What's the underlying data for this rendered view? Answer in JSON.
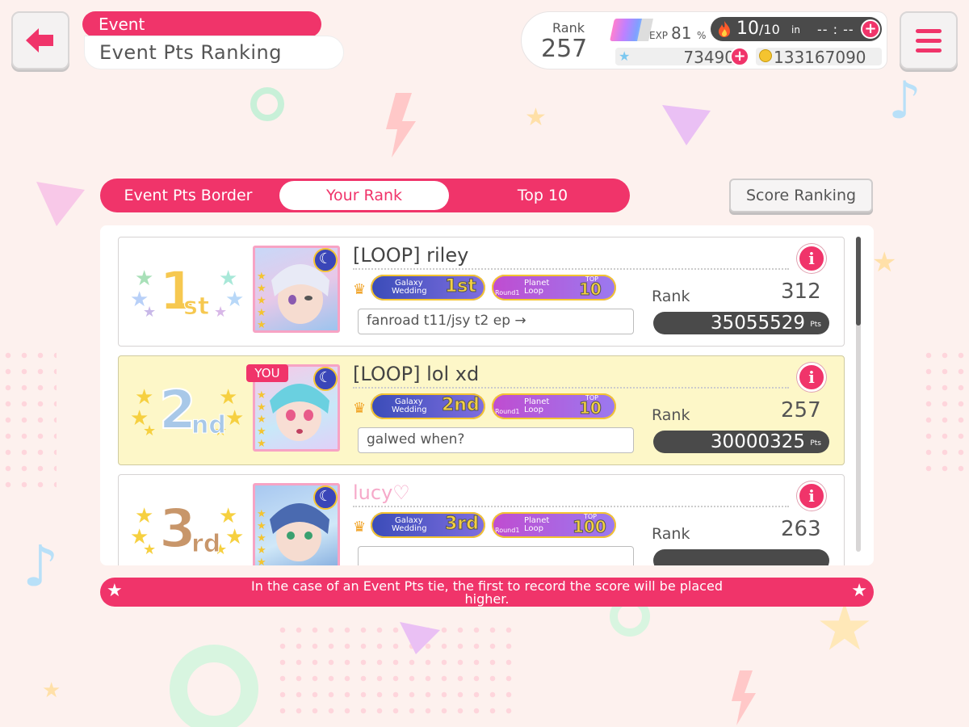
{
  "header": {
    "tag": "Event",
    "title": "Event Pts Ranking"
  },
  "status": {
    "rank_label": "Rank",
    "rank_value": "257",
    "exp_label": "EXP",
    "exp_value": "81",
    "exp_unit": "%",
    "stamina_current": "10",
    "stamina_max": "/10",
    "stamina_in": "in",
    "stamina_timer": "-- : --",
    "stars": "73490",
    "coins": "133167090"
  },
  "tabs": [
    {
      "label": "Event Pts Border"
    },
    {
      "label": "Your Rank"
    },
    {
      "label": "Top 10"
    }
  ],
  "score_ranking_label": "Score Ranking",
  "rows": [
    {
      "place_num": "1",
      "place_suffix": "st",
      "name": "[LOOP] riley",
      "comment": "fanroad t11/jsy t2 ep →",
      "rank_label": "Rank",
      "rank": "312",
      "points": "35055529",
      "pts_unit": "Pts",
      "badge1_line1": "Galaxy",
      "badge1_line2": "Wedding",
      "badge1_rank": "1st",
      "badge2_round": "Round1",
      "badge2_line1": "Planet",
      "badge2_line2": "Loop",
      "badge2_top_label": "TOP",
      "badge2_top": "10"
    },
    {
      "place_num": "2",
      "place_suffix": "nd",
      "name": "[LOOP] lol xd",
      "comment": "galwed when?",
      "rank_label": "Rank",
      "rank": "257",
      "points": "30000325",
      "pts_unit": "Pts",
      "you_label": "YOU",
      "badge1_line1": "Galaxy",
      "badge1_line2": "Wedding",
      "badge1_rank": "2nd",
      "badge2_round": "Round1",
      "badge2_line1": "Planet",
      "badge2_line2": "Loop",
      "badge2_top_label": "TOP",
      "badge2_top": "10"
    },
    {
      "place_num": "3",
      "place_suffix": "rd",
      "name": "lucy♡",
      "comment": "",
      "rank_label": "Rank",
      "rank": "263",
      "badge1_line1": "Galaxy",
      "badge1_line2": "Wedding",
      "badge1_rank": "3rd",
      "badge2_round": "Round1",
      "badge2_line1": "Planet",
      "badge2_line2": "Loop",
      "badge2_top_label": "TOP",
      "badge2_top": "100"
    }
  ],
  "notice": "In the case of an Event Pts tie, the first to record the score will be placed higher.",
  "icons": {
    "back": "arrow-left-icon",
    "menu": "hamburger-icon",
    "info": "info-icon",
    "stamina": "flame-icon",
    "star_currency": "star-icon",
    "coin_currency": "coin-icon"
  },
  "colors": {
    "accent": "#f0346a",
    "background": "#fdf1ee",
    "highlight_row": "#fdf7c8",
    "dark_pill": "#4a4a4a"
  }
}
